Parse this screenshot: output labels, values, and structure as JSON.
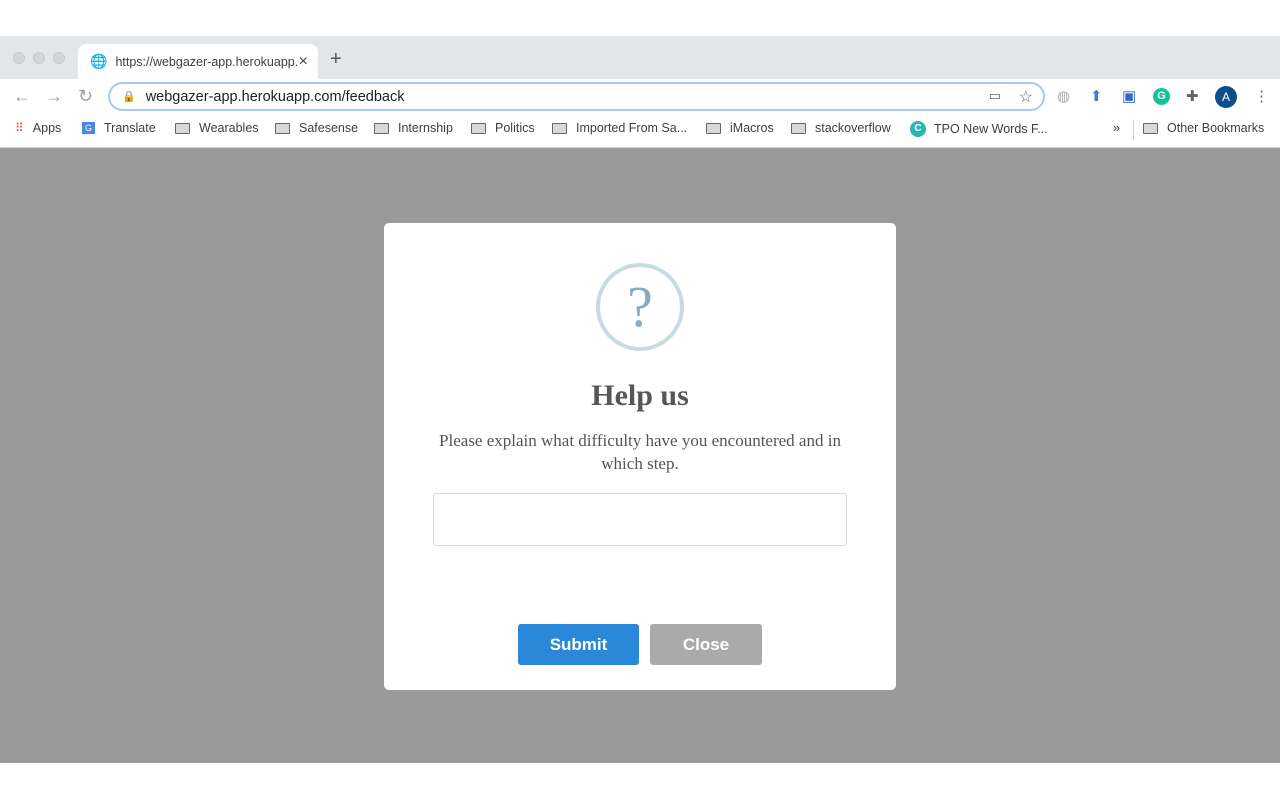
{
  "browser": {
    "tab_title": "https://webgazer-app.herokuapp.com/feedback",
    "new_tab": "+",
    "tab_close": "×",
    "url": "webgazer-app.herokuapp.com/feedback",
    "profile_initial": "A",
    "bookmarks": [
      "Apps",
      "Translate",
      "Wearables",
      "Safesense",
      "Internship",
      "Politics",
      "Imported From Sa...",
      "iMacros",
      "stackoverflow",
      "TPO New Words F..."
    ],
    "overflow": "»",
    "other_bookmarks": "Other Bookmarks"
  },
  "modal": {
    "icon": "question-mark-icon",
    "icon_glyph": "?",
    "title": "Help us",
    "description": "Please explain what difficulty have you encountered and in which step.",
    "input_value": "",
    "submit_label": "Submit",
    "close_label": "Close"
  },
  "colors": {
    "submit": "#2b88d8",
    "close": "#aaaaaa",
    "overlay": "#9a9a9a",
    "icon": "#87adbd"
  }
}
